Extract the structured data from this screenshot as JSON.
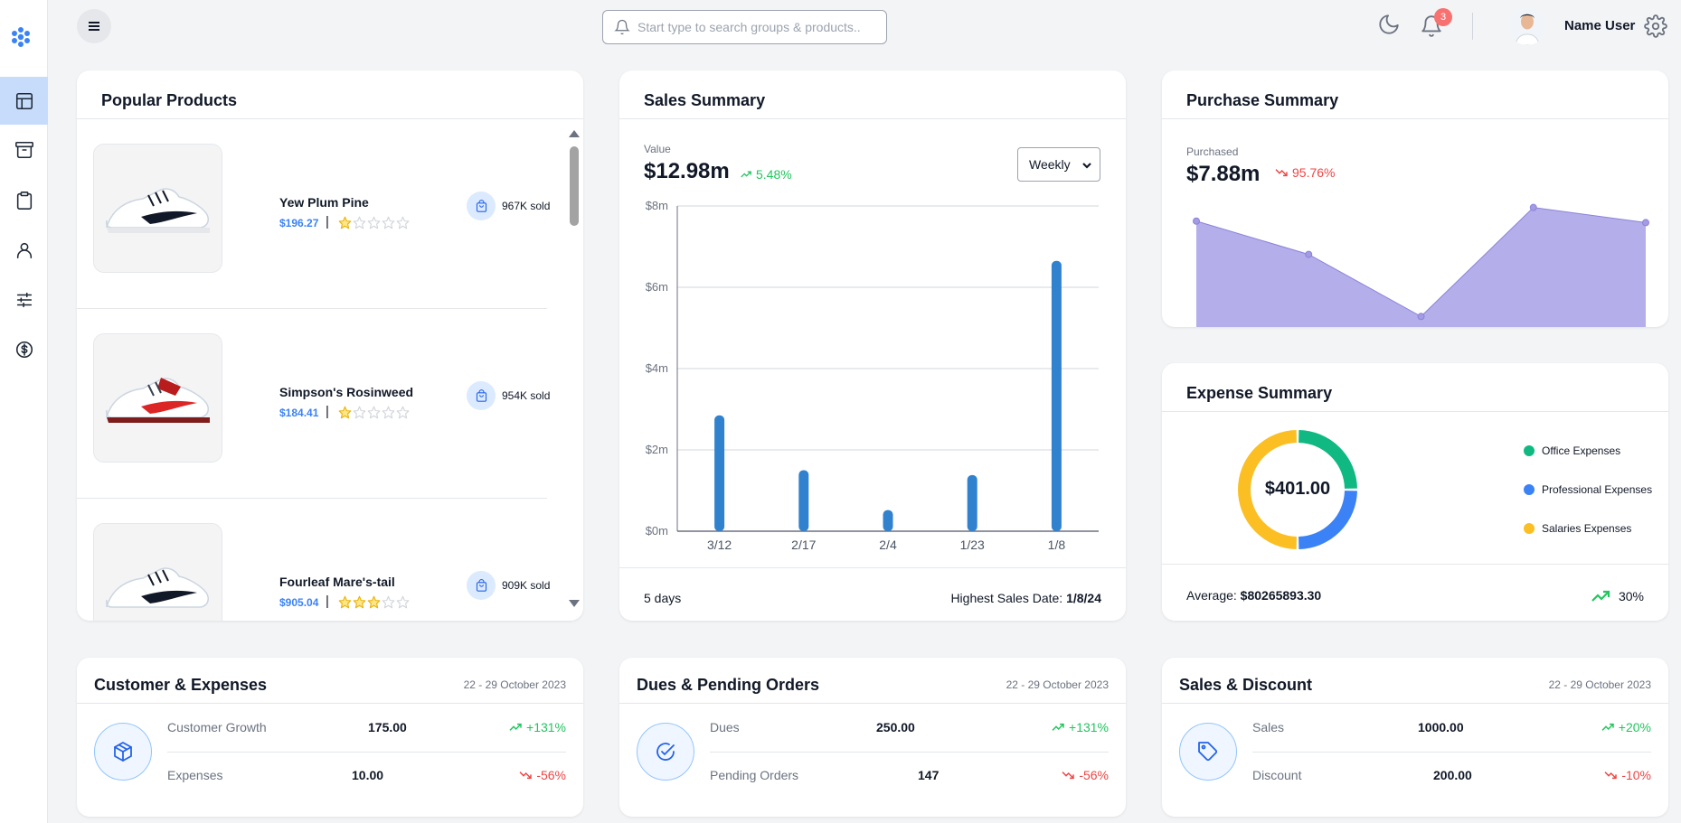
{
  "topbar": {
    "search_placeholder": "Start type to search groups & products..",
    "notification_count": "3",
    "user_name": "Name User"
  },
  "sidebar": {
    "items": [
      {
        "icon": "layout-icon",
        "active": true
      },
      {
        "icon": "archive-icon",
        "active": false
      },
      {
        "icon": "clipboard-icon",
        "active": false
      },
      {
        "icon": "user-icon",
        "active": false
      },
      {
        "icon": "sliders-icon",
        "active": false
      },
      {
        "icon": "dollar-circle-icon",
        "active": false
      }
    ]
  },
  "popular_products": {
    "title": "Popular Products",
    "products": [
      {
        "name": "Yew Plum Pine",
        "price": "$196.27",
        "rating": 1,
        "sold": "967K sold"
      },
      {
        "name": "Simpson's Rosinweed",
        "price": "$184.41",
        "rating": 1,
        "sold": "954K sold"
      },
      {
        "name": "Fourleaf Mare's-tail",
        "price": "$905.04",
        "rating": 3,
        "sold": "909K sold"
      }
    ]
  },
  "sales_summary": {
    "title": "Sales Summary",
    "value_label": "Value",
    "value": "$12.98m",
    "change": "5.48%",
    "period": "Weekly",
    "days": "5 days",
    "highest_label": "Highest Sales Date:",
    "highest_date": "1/8/24"
  },
  "purchase_summary": {
    "title": "Purchase Summary",
    "label": "Purchased",
    "value": "$7.88m",
    "change": "95.76%"
  },
  "expense_summary": {
    "title": "Expense Summary",
    "total": "$401.00",
    "legend": [
      {
        "label": "Office Expenses",
        "color": "#10b981"
      },
      {
        "label": "Professional Expenses",
        "color": "#3b82f6"
      },
      {
        "label": "Salaries Expenses",
        "color": "#fbbf24"
      }
    ],
    "average_label": "Average:",
    "average_value": "$80265893.30",
    "growth": "30%"
  },
  "customer_expenses": {
    "title": "Customer & Expenses",
    "date_range": "22 - 29 October 2023",
    "rows": [
      {
        "label": "Customer Growth",
        "value": "175.00",
        "change": "+131%",
        "trend": "up"
      },
      {
        "label": "Expenses",
        "value": "10.00",
        "change": "-56%",
        "trend": "down"
      }
    ]
  },
  "dues_pending": {
    "title": "Dues & Pending Orders",
    "date_range": "22 - 29 October 2023",
    "rows": [
      {
        "label": "Dues",
        "value": "250.00",
        "change": "+131%",
        "trend": "up"
      },
      {
        "label": "Pending Orders",
        "value": "147",
        "change": "-56%",
        "trend": "down"
      }
    ]
  },
  "sales_discount": {
    "title": "Sales & Discount",
    "date_range": "22 - 29 October 2023",
    "rows": [
      {
        "label": "Sales",
        "value": "1000.00",
        "change": "+20%",
        "trend": "up"
      },
      {
        "label": "Discount",
        "value": "200.00",
        "change": "-10%",
        "trend": "down"
      }
    ]
  },
  "colors": {
    "accent": "#3b82f6",
    "bar": "#3182ce",
    "area": "#b4aeea",
    "up": "#22c55e",
    "down": "#ef4444"
  },
  "chart_data": [
    {
      "type": "bar",
      "categories": [
        "3/12",
        "2/17",
        "2/4",
        "1/23",
        "1/8"
      ],
      "values": [
        2.85,
        1.5,
        0.52,
        1.38,
        6.65
      ],
      "ylim": [
        0,
        8
      ],
      "yticks": [
        "$0m",
        "$2m",
        "$4m",
        "$6m",
        "$8m"
      ],
      "grid": true
    },
    {
      "type": "area",
      "values": [
        7.0,
        4.8,
        0.7,
        7.9,
        6.9
      ],
      "ylim": [
        0,
        8
      ]
    },
    {
      "type": "pie",
      "categories": [
        "Office Expenses",
        "Professional Expenses",
        "Salaries Expenses"
      ],
      "values": [
        25,
        25,
        50
      ]
    }
  ]
}
